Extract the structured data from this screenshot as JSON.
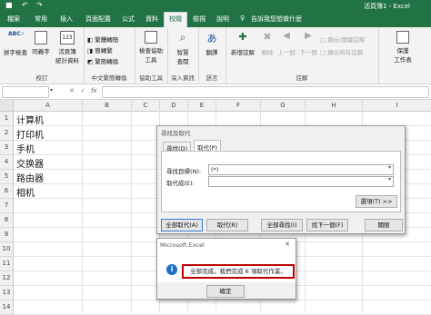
{
  "titlebar": {
    "doc_title": "活頁簿1 - Excel",
    "save_icon": "save-icon",
    "undo_icon": "undo-icon",
    "redo_icon": "redo-icon"
  },
  "tabs": [
    {
      "label": "檔案"
    },
    {
      "label": "常用"
    },
    {
      "label": "插入"
    },
    {
      "label": "頁面配置"
    },
    {
      "label": "公式"
    },
    {
      "label": "資料"
    },
    {
      "label": "校閱"
    },
    {
      "label": "檢視"
    },
    {
      "label": "說明"
    }
  ],
  "tell_me": "告訴我您想做什麼",
  "ribbon": {
    "proofing": {
      "spell": "拼字檢查",
      "thesaurus": "同義字",
      "stats_line1": "活頁簿",
      "stats_line2": "統計資料",
      "label": "校訂"
    },
    "chinese": {
      "to_trad": "繁體轉簡",
      "to_simp": "簡轉繁",
      "convert": "繁簡轉換",
      "label": "中文繁簡轉換"
    },
    "accessibility": {
      "check_line1": "檢查協助",
      "check_line2": "工具",
      "label": "協助工具"
    },
    "insights": {
      "smart_line1": "智慧",
      "smart_line2": "查閱",
      "label": "深入資訊"
    },
    "language": {
      "translate": "翻譯",
      "label": "語言"
    },
    "comments": {
      "new": "新增註解",
      "delete": "刪除",
      "prev": "上一個",
      "next": "下一個",
      "show_hide": "顯示/隱藏註解",
      "show_all": "顯示所有註解",
      "label": "註解"
    },
    "protect": {
      "sheet_line1": "保護",
      "sheet_line2": "工作表"
    }
  },
  "formula_bar": {
    "fx": "fx"
  },
  "columns": [
    "A",
    "B",
    "C",
    "D",
    "E",
    "F",
    "G",
    "H",
    "I"
  ],
  "rows": [
    "1",
    "2",
    "3",
    "4",
    "5",
    "6",
    "7",
    "8",
    "9",
    "10",
    "11",
    "12",
    "13",
    "14"
  ],
  "cells": [
    "计算机",
    "打印机",
    "手机",
    "交换器",
    "路由器",
    "相机"
  ],
  "find_dialog": {
    "title": "尋找及取代",
    "tab_find": "尋找(D)",
    "tab_replace": "取代(P)",
    "find_label": "尋找目標(N):",
    "find_value": "(*)",
    "replace_label": "取代成(E):",
    "replace_value": "",
    "options": "選項(T) >>",
    "replace_all": "全部取代(A)",
    "replace": "取代(R)",
    "find_all": "全部尋找(I)",
    "find_next": "找下一個(F)",
    "close": "關閉"
  },
  "msg_dialog": {
    "title": "Microsoft Excel",
    "info_icon": "info-icon",
    "message": "全部完成。我們完成 6 項取代作業。",
    "ok": "確定"
  },
  "colors": {
    "excel_green": "#217346",
    "highlight": "#c00000",
    "info_blue": "#1e6fc9"
  }
}
